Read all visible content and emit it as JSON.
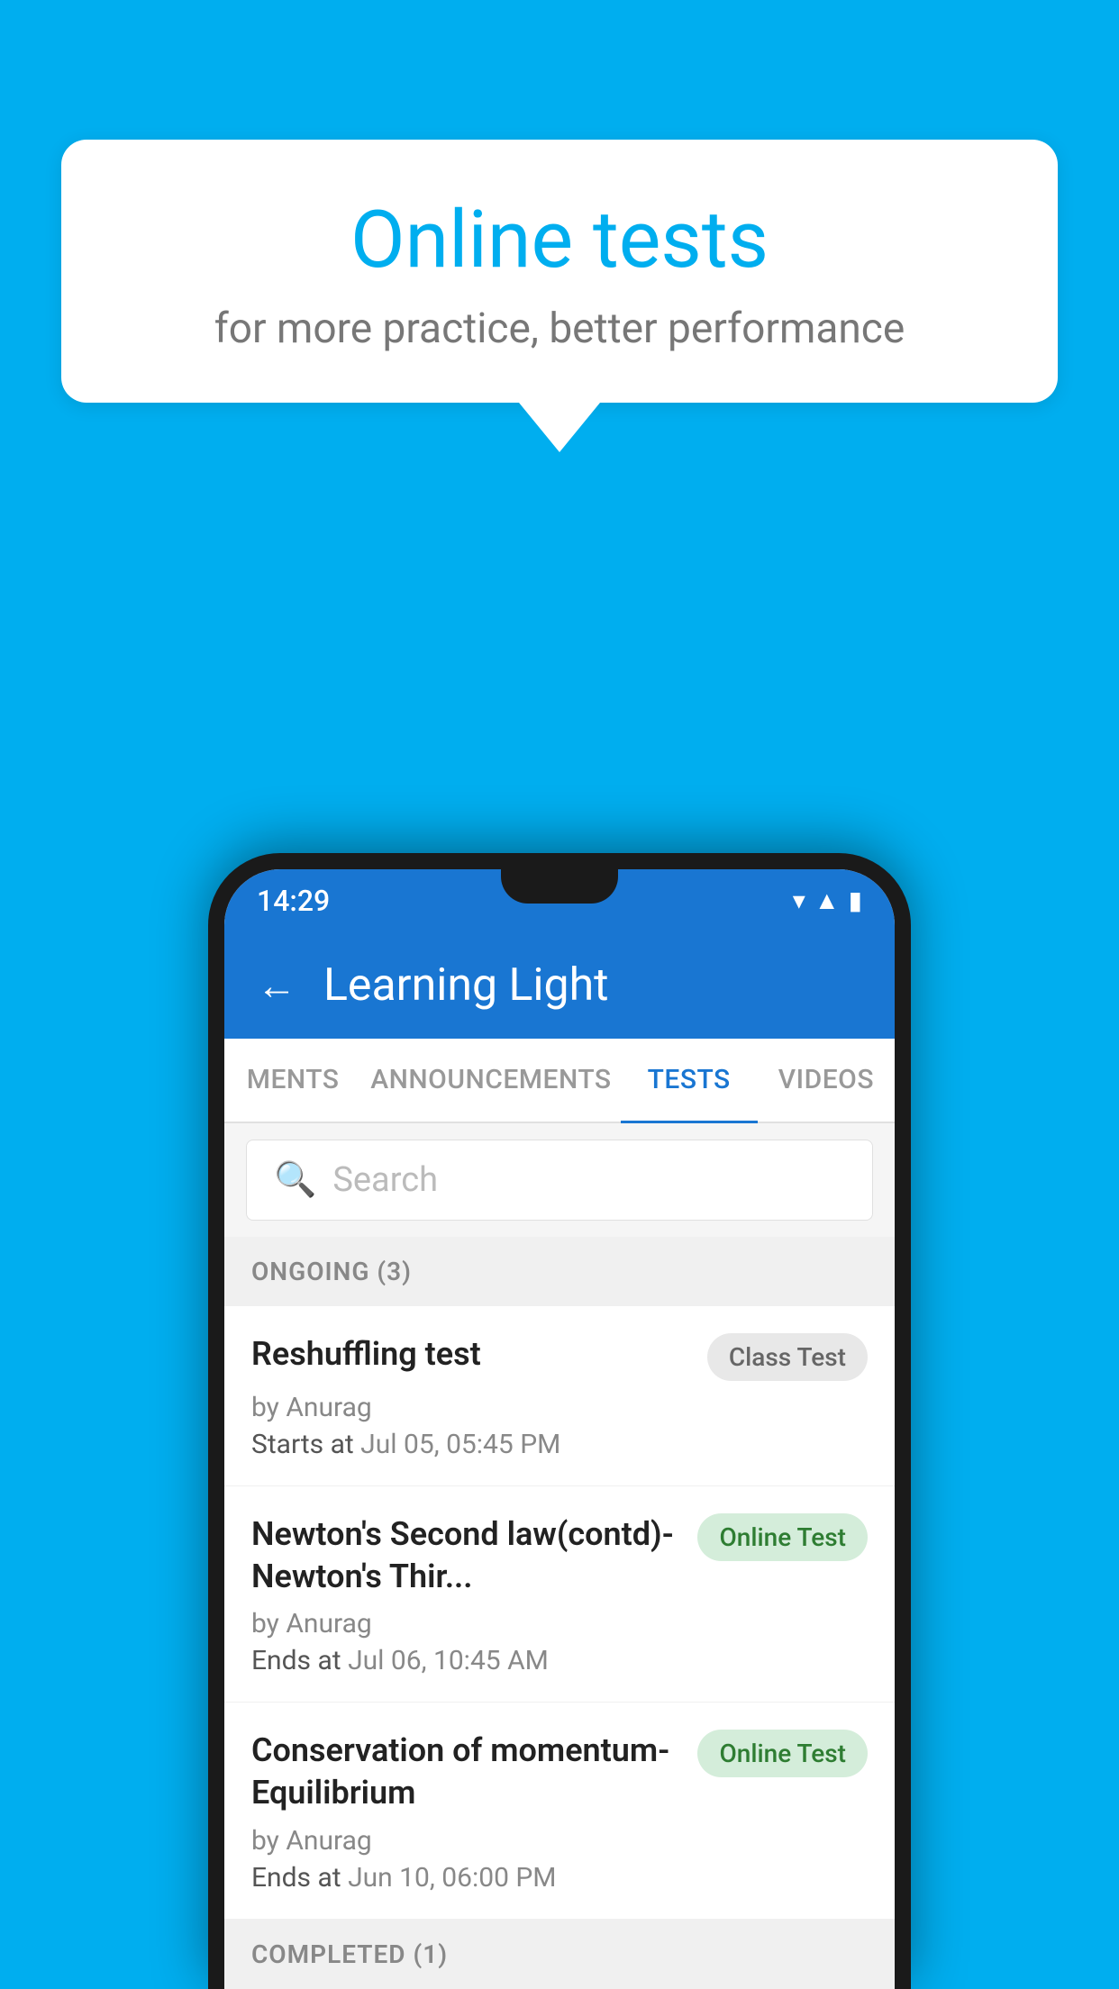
{
  "background": {
    "color": "#00AEEF"
  },
  "speech_bubble": {
    "title": "Online tests",
    "subtitle": "for more practice, better performance"
  },
  "app": {
    "status_time": "14:29",
    "title": "Learning Light",
    "back_label": "←",
    "tabs": [
      {
        "id": "ments",
        "label": "MENTS",
        "active": false
      },
      {
        "id": "announcements",
        "label": "ANNOUNCEMENTS",
        "active": false
      },
      {
        "id": "tests",
        "label": "TESTS",
        "active": true
      },
      {
        "id": "videos",
        "label": "VIDEOS",
        "active": false
      }
    ],
    "search": {
      "placeholder": "Search"
    },
    "ongoing_section": {
      "label": "ONGOING (3)"
    },
    "test_items": [
      {
        "name": "Reshuffling test",
        "badge": "Class Test",
        "badge_type": "class",
        "author": "by Anurag",
        "date_label": "Starts at",
        "date": "Jul 05, 05:45 PM"
      },
      {
        "name": "Newton's Second law(contd)-Newton's Thir...",
        "badge": "Online Test",
        "badge_type": "online",
        "author": "by Anurag",
        "date_label": "Ends at",
        "date": "Jul 06, 10:45 AM"
      },
      {
        "name": "Conservation of momentum-Equilibrium",
        "badge": "Online Test",
        "badge_type": "online",
        "author": "by Anurag",
        "date_label": "Ends at",
        "date": "Jun 10, 06:00 PM"
      }
    ],
    "completed_section": {
      "label": "COMPLETED (1)"
    }
  }
}
